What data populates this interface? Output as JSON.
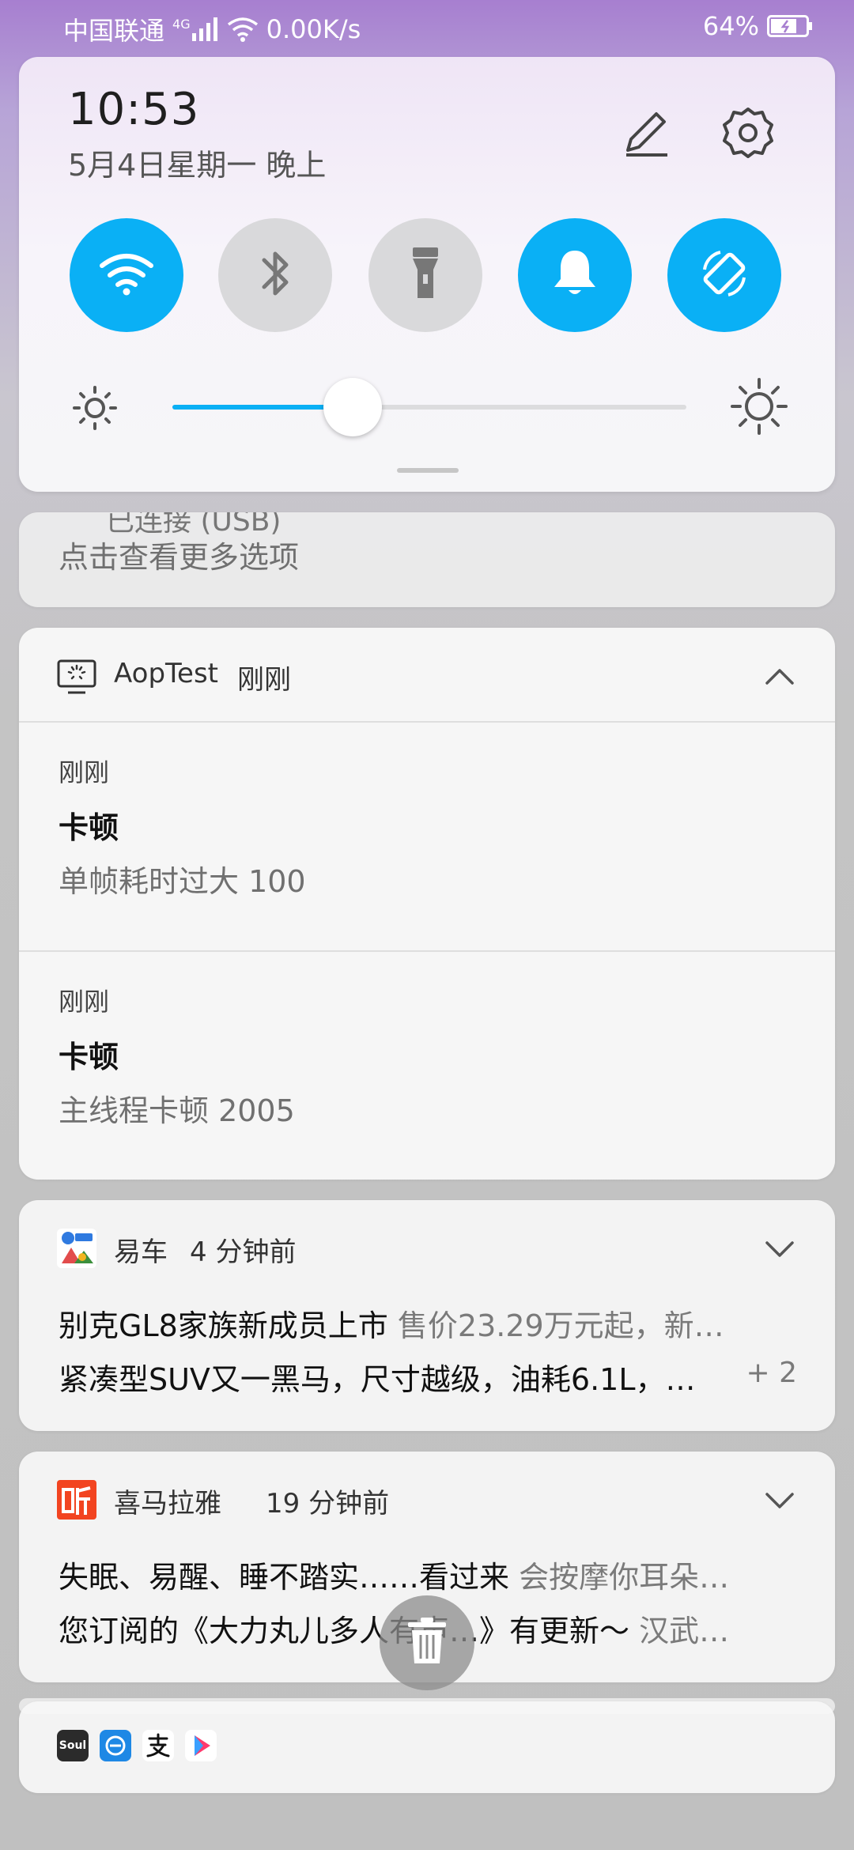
{
  "status_bar": {
    "carrier": "中国联通",
    "network_type": "4G",
    "speed": "0.00K/s",
    "battery": "64%"
  },
  "quick_settings": {
    "time": "10:53",
    "date": "5月4日星期一 晚上",
    "toggles": [
      {
        "name": "wifi",
        "state": "on"
      },
      {
        "name": "bluetooth",
        "state": "off"
      },
      {
        "name": "flashlight",
        "state": "off"
      },
      {
        "name": "sound",
        "state": "on"
      },
      {
        "name": "auto-rotate",
        "state": "on"
      }
    ],
    "brightness_level": 0.35,
    "accent_color": "#0ab0f5"
  },
  "peek_notification": {
    "clipped_title": "已连接 (USB)",
    "subtitle": "点击查看更多选项"
  },
  "aoptest": {
    "app_name": "AopTest",
    "time": "刚刚",
    "messages": [
      {
        "time": "刚刚",
        "title": "卡顿",
        "body": "单帧耗时过大 100"
      },
      {
        "time": "刚刚",
        "title": "卡顿",
        "body": "主线程卡顿 2005"
      }
    ]
  },
  "yiche": {
    "app_name": "易车",
    "time": "4 分钟前",
    "line1_title": "别克GL8家族新成员上市",
    "line1_text": "售价23.29万元起，新…",
    "line2_title": "紧凑型SUV又一黑马，尺寸越级，油耗6.1L，…",
    "more_count": "+ 2"
  },
  "ximalaya": {
    "app_name": "喜马拉雅",
    "time": "19 分钟前",
    "line1_title": "失眠、易醒、睡不踏实……看过来",
    "line1_text": "会按摩你耳朵…",
    "line2_title": "您订阅的《大力丸儿多人有声…》有更新～",
    "line2_text": "汉武…"
  },
  "grouped": {
    "icons": [
      "soul-icon",
      "mail-icon",
      "alipay-icon",
      "youku-icon"
    ],
    "soul_label": "Soul"
  }
}
